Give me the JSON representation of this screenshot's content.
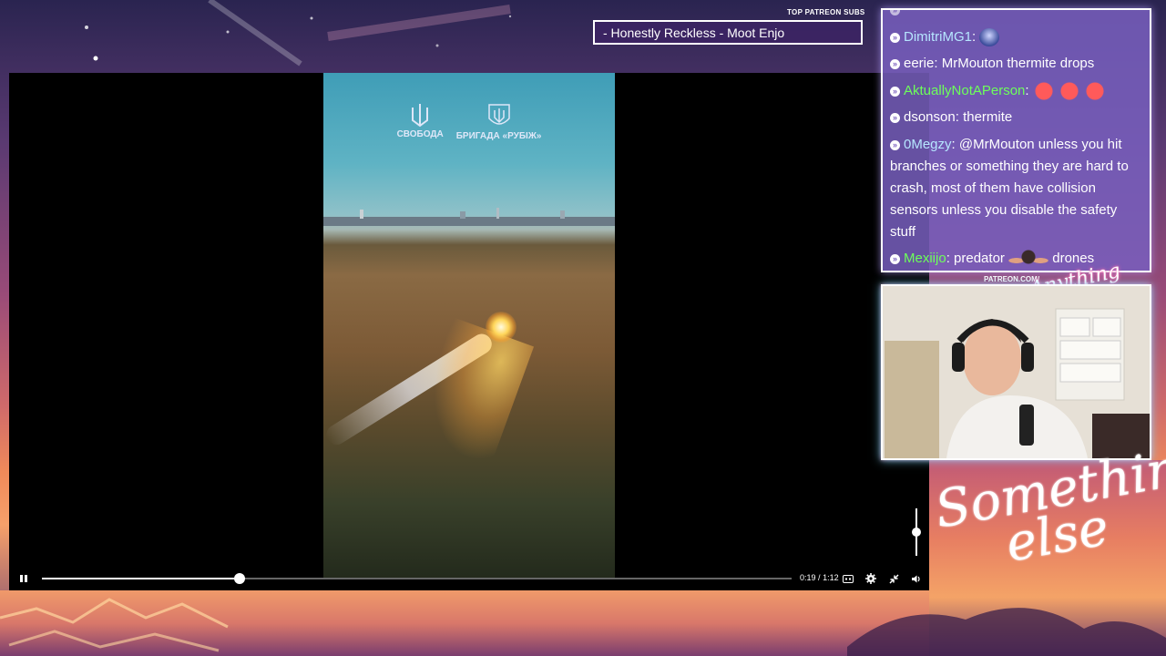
{
  "player": {
    "watermark_left": "СВОБОДА",
    "watermark_right": "БРИГАДА «РУБІЖ»",
    "time_current": "0:19",
    "time_separator": "/",
    "time_total": "1:12",
    "progress_fraction": 0.264,
    "volume_fraction": 0.5
  },
  "patreon": {
    "title": "TOP PATREON SUBS",
    "ticker": "- Honestly Reckless - Moot Enjo"
  },
  "chat": {
    "messages": [
      {
        "user": "DimitriMG1",
        "sep": ":",
        "text": "",
        "user_color": "#b6e6ff",
        "emote": "wizard-emote"
      },
      {
        "user": "eerie",
        "sep": ":",
        "text": "MrMouton thermite drops",
        "user_color": "#ffffff"
      },
      {
        "user": "AktuallyNotAPerson",
        "sep": ":",
        "text": "",
        "user_color": "#6dff5a",
        "emote": "red-emotes"
      },
      {
        "user": "dsonson",
        "sep": ":",
        "text": "thermite",
        "user_color": "#ffffff"
      },
      {
        "user": "0Megzy",
        "sep": ":",
        "text": "@MrMouton unless you hit branches or something they are hard to crash, most of them have collision sensors unless you disable the safety stuff",
        "user_color": "#b6e6ff"
      },
      {
        "user": "Mexiijo",
        "sep": ":",
        "text": "predator",
        "text2": "drones",
        "user_color": "#6dff5a",
        "emote": "predator-emote"
      }
    ]
  },
  "branding": {
    "patreon_url": "PATREON.COM/",
    "top_script": "Anything else",
    "big_line1": "Something",
    "big_line2": "else"
  },
  "colors": {
    "chat_bg": "#785fbe",
    "accent_green": "#6dff5a",
    "accent_blue": "#b6e6ff"
  }
}
